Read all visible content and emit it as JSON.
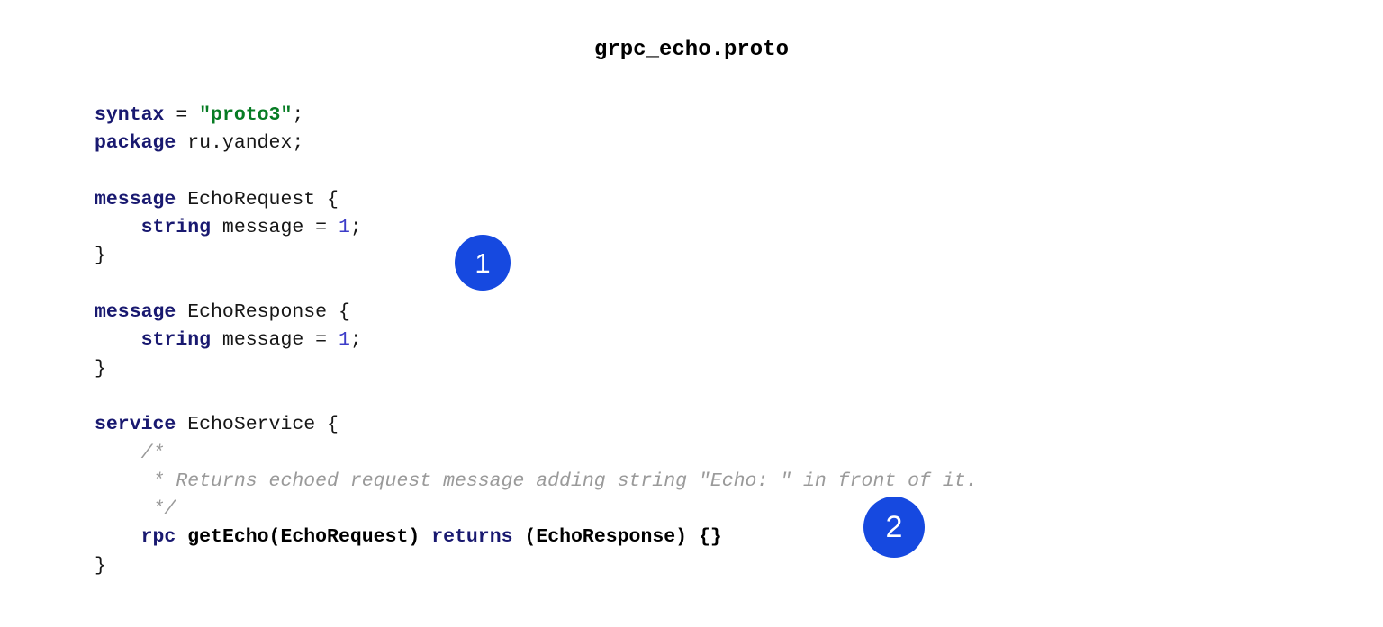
{
  "document": {
    "title": "grpc_echo.proto",
    "background_color": "#ffffff",
    "language": "protobuf"
  },
  "theme": {
    "keyword_color": "#191970",
    "string_color": "#077C24",
    "number_color": "#3c3cc8",
    "plain_color": "#161616",
    "comment_color": "#9a9a9a",
    "badge_color": "#1649E0",
    "badge_text_color": "#ffffff"
  },
  "code": {
    "lines": [
      {
        "index": 1,
        "text": "syntax = \"proto3\";",
        "tokens": [
          {
            "t": "syntax",
            "k": "kw"
          },
          {
            "t": " = ",
            "k": "plain"
          },
          {
            "t": "\"proto3\"",
            "k": "str"
          },
          {
            "t": ";",
            "k": "plain"
          }
        ]
      },
      {
        "index": 2,
        "text": "package ru.yandex;",
        "tokens": [
          {
            "t": "package",
            "k": "kw"
          },
          {
            "t": " ru.yandex;",
            "k": "plain"
          }
        ]
      },
      {
        "index": 3,
        "text": "",
        "tokens": []
      },
      {
        "index": 4,
        "text": "message EchoRequest {",
        "tokens": [
          {
            "t": "message",
            "k": "kw"
          },
          {
            "t": " EchoRequest {",
            "k": "plain"
          }
        ]
      },
      {
        "index": 5,
        "text": "    string message = 1;",
        "tokens": [
          {
            "t": "    ",
            "k": "plain"
          },
          {
            "t": "string",
            "k": "kw"
          },
          {
            "t": " message = ",
            "k": "plain"
          },
          {
            "t": "1",
            "k": "num"
          },
          {
            "t": ";",
            "k": "plain"
          }
        ]
      },
      {
        "index": 6,
        "text": "}",
        "tokens": [
          {
            "t": "}",
            "k": "plain"
          }
        ]
      },
      {
        "index": 7,
        "text": "",
        "tokens": []
      },
      {
        "index": 8,
        "text": "message EchoResponse {",
        "tokens": [
          {
            "t": "message",
            "k": "kw"
          },
          {
            "t": " EchoResponse {",
            "k": "plain"
          }
        ]
      },
      {
        "index": 9,
        "text": "    string message = 1;",
        "tokens": [
          {
            "t": "    ",
            "k": "plain"
          },
          {
            "t": "string",
            "k": "kw"
          },
          {
            "t": " message = ",
            "k": "plain"
          },
          {
            "t": "1",
            "k": "num"
          },
          {
            "t": ";",
            "k": "plain"
          }
        ]
      },
      {
        "index": 10,
        "text": "}",
        "tokens": [
          {
            "t": "}",
            "k": "plain"
          }
        ]
      },
      {
        "index": 11,
        "text": "",
        "tokens": []
      },
      {
        "index": 12,
        "text": "service EchoService {",
        "tokens": [
          {
            "t": "service",
            "k": "kw"
          },
          {
            "t": " EchoService {",
            "k": "plain"
          }
        ]
      },
      {
        "index": 13,
        "text": "    /*",
        "tokens": [
          {
            "t": "    ",
            "k": "plain"
          },
          {
            "t": "/*",
            "k": "comment"
          }
        ]
      },
      {
        "index": 14,
        "text": "     * Returns echoed request message adding string \"Echo: \" in front of it.",
        "tokens": [
          {
            "t": "     ",
            "k": "plain"
          },
          {
            "t": "* Returns echoed request message adding string \"Echo: \" in front of it.",
            "k": "comment"
          }
        ]
      },
      {
        "index": 15,
        "text": "     */",
        "tokens": [
          {
            "t": "     ",
            "k": "plain"
          },
          {
            "t": "*/",
            "k": "comment"
          }
        ]
      },
      {
        "index": 16,
        "text": "    rpc getEcho(EchoRequest) returns (EchoResponse) {}",
        "tokens": [
          {
            "t": "    ",
            "k": "plain"
          },
          {
            "t": "rpc",
            "k": "kw"
          },
          {
            "t": " ",
            "k": "plain"
          },
          {
            "t": "getEcho(EchoRequest)",
            "k": "bold"
          },
          {
            "t": " ",
            "k": "plain"
          },
          {
            "t": "returns",
            "k": "kw"
          },
          {
            "t": " ",
            "k": "plain"
          },
          {
            "t": "(EchoResponse) {}",
            "k": "bold"
          }
        ]
      },
      {
        "index": 17,
        "text": "}",
        "tokens": [
          {
            "t": "}",
            "k": "plain"
          }
        ]
      }
    ]
  },
  "annotations": {
    "markers": [
      {
        "label": "1",
        "target_line": 5,
        "description": "marker pointing at EchoRequest message body"
      },
      {
        "label": "2",
        "target_line": 16,
        "description": "marker pointing at the getEcho rpc definition"
      }
    ]
  }
}
